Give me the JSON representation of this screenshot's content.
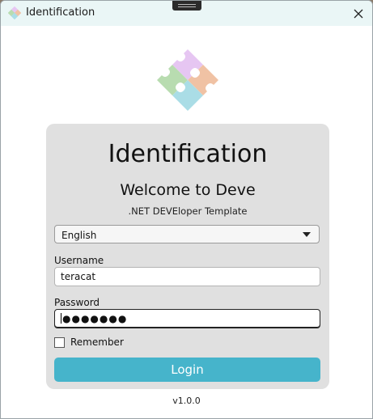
{
  "window": {
    "title": "Identification",
    "icon": "puzzle-icon",
    "close_icon": "close-icon"
  },
  "logo": {
    "icon": "puzzle-logo",
    "colors": [
      "#e6c6f2",
      "#f0c2a4",
      "#b8dcb0",
      "#aadde6"
    ]
  },
  "card": {
    "title": "Identification",
    "subtitle": "Welcome to Deve",
    "tagline": ".NET DEVEloper Template"
  },
  "language": {
    "selected": "English"
  },
  "username": {
    "label": "Username",
    "value": "teracat"
  },
  "password": {
    "label": "Password",
    "masked_value": "●●●●●●●"
  },
  "remember": {
    "label": "Remember",
    "checked": false
  },
  "login": {
    "label": "Login",
    "color": "#46b4cb"
  },
  "footer": {
    "version": "v1.0.0"
  }
}
